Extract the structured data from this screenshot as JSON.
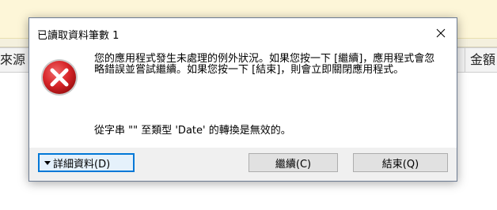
{
  "background": {
    "column_left_label": "來源",
    "column_right_label": "金額"
  },
  "dialog": {
    "title": "已讀取資料筆數 1",
    "message_line": "您的應用程式發生未處理的例外狀況。如果您按一下 [繼續]，應用程式會忽略錯誤並嘗試繼續。如果您按一下 [結束]，則會立即關閉應用程式。",
    "detail_message": "從字串 \"\" 至類型 'Date' 的轉換是無效的。",
    "buttons": {
      "details_label": "詳細資料(D)",
      "continue_label": "繼續(C)",
      "quit_label": "結束(Q)"
    },
    "icons": {
      "error": "error-icon",
      "close": "close-icon",
      "expand": "caret-down-icon"
    },
    "colors": {
      "error_red": "#d8262a",
      "focus_blue": "#0078d7"
    }
  }
}
